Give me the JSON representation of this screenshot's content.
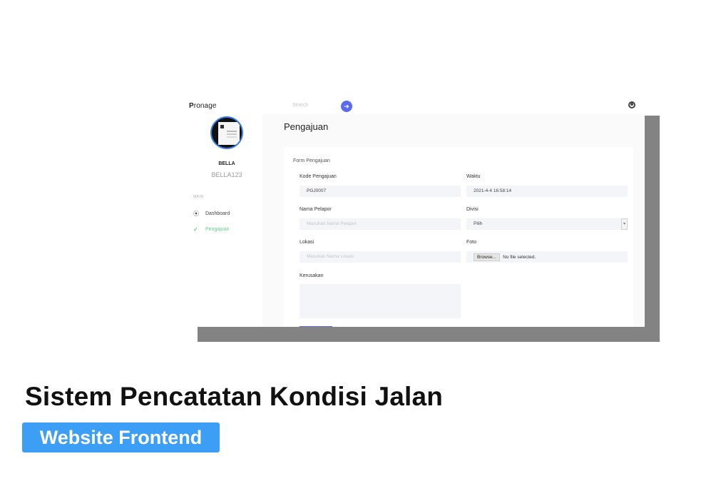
{
  "app": {
    "brand": "Pronage",
    "brand_first": "P",
    "brand_rest": "ronage"
  },
  "user": {
    "name": "BELLA",
    "id": "BELLA123"
  },
  "nav": {
    "section": "MAIN",
    "items": [
      {
        "label": "Dashboard",
        "icon": "dashboard-icon",
        "active": false
      },
      {
        "label": "Pengajuan",
        "icon": "check-icon",
        "active": true
      }
    ]
  },
  "topbar": {
    "search_placeholder": "Search",
    "search_button_icon": "arrow-right-icon",
    "user_icon": "user-circle-icon"
  },
  "page": {
    "title": "Pengajuan"
  },
  "form": {
    "title": "Form Pengajuan",
    "kode": {
      "label": "Kode Pengajuan",
      "value": "PGJ0007"
    },
    "waktu": {
      "label": "Waktu",
      "value": "2021-4-4 16:58:14"
    },
    "pelapor": {
      "label": "Nama Pelapor",
      "placeholder": "Masukan Nama Pelapor"
    },
    "divisi": {
      "label": "Divisi",
      "value": "Pilih"
    },
    "lokasi": {
      "label": "Lokasi",
      "placeholder": "Masukan Nama Lokasi"
    },
    "foto": {
      "label": "Foto",
      "button": "Browse...",
      "status": "No file selected."
    },
    "kerusakan": {
      "label": "Kerusakan"
    }
  },
  "caption": {
    "headline": "Sistem Pencatatan Kondisi Jalan",
    "badge": "Website Frontend"
  },
  "colors": {
    "accent": "#5b6bf0",
    "active_nav": "#5dd38a",
    "badge": "#3c9ef5",
    "frame_shadow": "#838383"
  }
}
